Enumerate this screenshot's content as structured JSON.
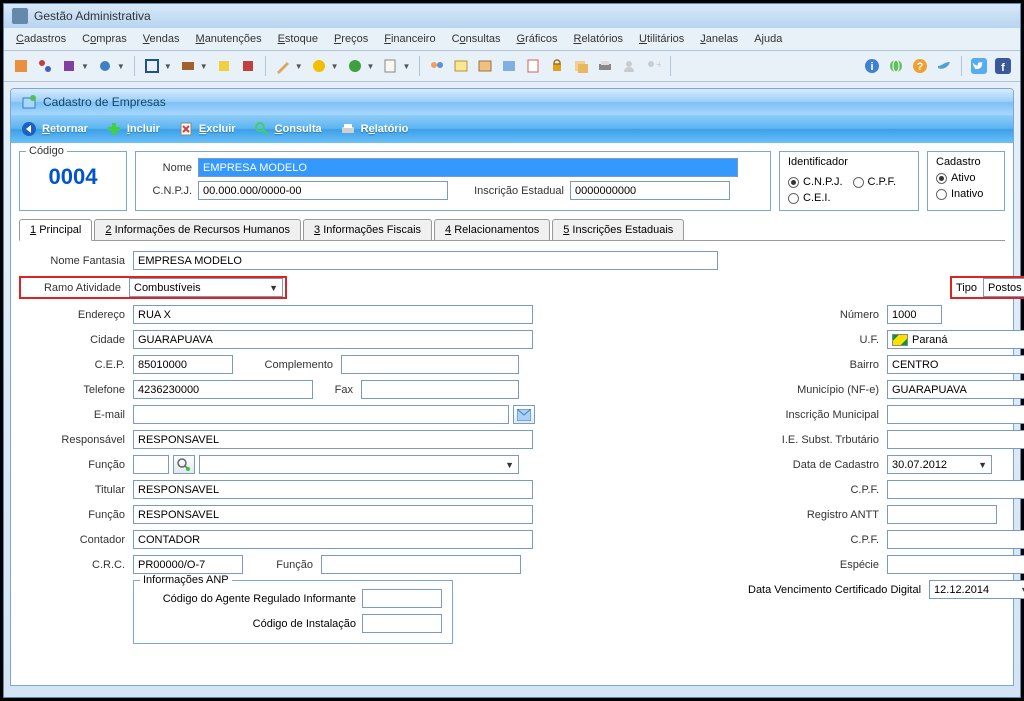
{
  "window": {
    "title": "Gestão Administrativa"
  },
  "menu": {
    "cadastros": "Cadastros",
    "compras": "Compras",
    "vendas": "Vendas",
    "manutencoes": "Manutenções",
    "estoque": "Estoque",
    "precos": "Preços",
    "financeiro": "Financeiro",
    "consultas": "Consultas",
    "graficos": "Gráficos",
    "relatorios": "Relatórios",
    "utilitarios": "Utilitários",
    "janelas": "Janelas",
    "ajuda": "Ajuda"
  },
  "subwindow": {
    "title": "Cadastro de Empresas"
  },
  "subtoolbar": {
    "retornar": "Retornar",
    "incluir": "Incluir",
    "excluir": "Excluir",
    "consulta": "Consulta",
    "relatorio": "Relatório"
  },
  "header": {
    "codigo_label": "Código",
    "codigo": "0004",
    "nome_label": "Nome",
    "nome": "EMPRESA MODELO",
    "cnpj_label": "C.N.P.J.",
    "cnpj": "00.000.000/0000-00",
    "inscest_label": "Inscrição Estadual",
    "inscest": "0000000000",
    "ident_label": "Identificador",
    "ident_cnpj": "C.N.P.J.",
    "ident_cpf": "C.P.F.",
    "ident_cei": "C.E.I.",
    "cad_label": "Cadastro",
    "cad_ativo": "Ativo",
    "cad_inativo": "Inativo"
  },
  "tabs": {
    "t1": "Principal",
    "t2": "Informações de Recursos Humanos",
    "t3": "Informações Fiscais",
    "t4": "Relacionamentos",
    "t5": "Inscrições Estaduais"
  },
  "form": {
    "nome_fantasia_label": "Nome Fantasia",
    "nome_fantasia": "EMPRESA MODELO",
    "ramo_label": "Ramo Atividade",
    "ramo": "Combustíveis",
    "tipo_label": "Tipo",
    "tipo": "Postos de Combustíve",
    "endereco_label": "Endereço",
    "endereco": "RUA X",
    "numero_label": "Número",
    "numero": "1000",
    "cidade_label": "Cidade",
    "cidade": "GUARAPUAVA",
    "uf_label": "U.F.",
    "uf": "Paraná",
    "cep_label": "C.E.P.",
    "cep": "85010000",
    "complemento_label": "Complemento",
    "complemento": "",
    "bairro_label": "Bairro",
    "bairro": "CENTRO",
    "telefone_label": "Telefone",
    "telefone": "4236230000",
    "fax_label": "Fax",
    "fax": "",
    "municipio_nfe_label": "Município (NF-e)",
    "municipio_nfe": "GUARAPUAVA",
    "email_label": "E-mail",
    "email": "",
    "inscmun_label": "Inscrição Municipal",
    "inscmun": "",
    "responsavel_label": "Responsável",
    "responsavel": "RESPONSAVEL",
    "iesubst_label": "I.E. Subst. Trbutário",
    "iesubst": "",
    "funcao1_label": "Função",
    "funcao1_code": "",
    "funcao1_desc": "",
    "datacad_label": "Data de Cadastro",
    "datacad": "30.07.2012",
    "titular_label": "Titular",
    "titular": "RESPONSAVEL",
    "cpf1_label": "C.P.F.",
    "cpf1": "",
    "funcao2_label": "Função",
    "funcao2": "RESPONSAVEL",
    "regantt_label": "Registro ANTT",
    "regantt": "",
    "contador_label": "Contador",
    "contador": "CONTADOR",
    "cpf2_label": "C.P.F.",
    "cpf2": "",
    "crc_label": "C.R.C.",
    "crc": "PR00000/O-7",
    "funcao3_label": "Função",
    "funcao3": "",
    "especie_label": "Espécie",
    "especie": "",
    "anp_legend": "Informações ANP",
    "anp_codigo_label": "Código do Agente Regulado Informante",
    "anp_codigo": "",
    "anp_instalacao_label": "Código de Instalação",
    "anp_instalacao": "",
    "venc_cert_label": "Data Vencimento Certificado Digital",
    "venc_cert": "12.12.2014"
  }
}
